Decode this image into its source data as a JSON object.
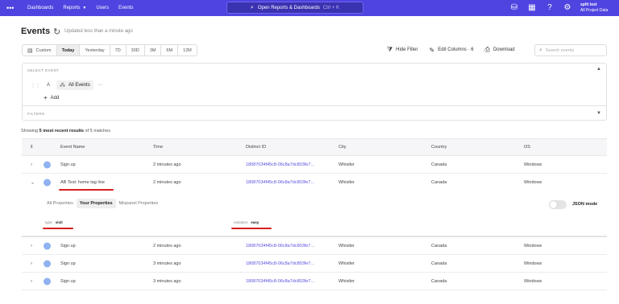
{
  "topnav": {
    "items": [
      {
        "label": "Dashboards"
      },
      {
        "label": "Reports"
      },
      {
        "label": "Users"
      },
      {
        "label": "Events"
      }
    ],
    "search_label": "Open Reports & Dashboards",
    "search_shortcut": "Ctrl + K",
    "user_name": "split test",
    "user_scope": "All Project Data"
  },
  "page": {
    "title": "Events",
    "updated": "Updated less than a minute ago"
  },
  "date_range": {
    "options": [
      "Custom",
      "Today",
      "Yesterday",
      "7D",
      "30D",
      "3M",
      "6M",
      "12M"
    ],
    "selected": "Today"
  },
  "toolbar": {
    "hide_filter": "Hide Filter",
    "edit_columns": "Edit Columns · 6",
    "download": "Download",
    "search_placeholder": "Search events"
  },
  "select_event": {
    "section_label": "SELECT EVENT",
    "letter": "A",
    "event_chip": "All Events",
    "more": "···",
    "add_label": "Add",
    "filters_label": "FILTERS"
  },
  "results": {
    "prefix": "Showing",
    "bold": "5 most recent results",
    "suffix": "of 5 matches"
  },
  "table": {
    "columns": [
      "Event Name",
      "Time",
      "Distinct ID",
      "City",
      "Country",
      "OS"
    ],
    "rows": [
      {
        "event": "Sign up",
        "time": "2 minutes ago",
        "distinct_id": "18087034f45c8-06c8a7dc803fe7...",
        "city": "Whistler",
        "country": "Canada",
        "os": "Windows"
      },
      {
        "event": "AB Test: home tag line",
        "time": "2 minutes ago",
        "distinct_id": "18087034f45c8-06c8a7dc803fe7...",
        "city": "Whistler",
        "country": "Canada",
        "os": "Windows"
      },
      {
        "event": "Sign up",
        "time": "2 minutes ago",
        "distinct_id": "18087034f45c8-06c8a7dc803fe7...",
        "city": "Whistler",
        "country": "Canada",
        "os": "Windows"
      },
      {
        "event": "Sign up",
        "time": "3 minutes ago",
        "distinct_id": "18087034f45c8-06c8a7dc803fe7...",
        "city": "Whistler",
        "country": "Canada",
        "os": "Windows"
      },
      {
        "event": "Sign up",
        "time": "3 minutes ago",
        "distinct_id": "18087034f45c8-06c8a7dc803fe7...",
        "city": "Whistler",
        "country": "Canada",
        "os": "Windows"
      }
    ]
  },
  "expanded": {
    "tabs": [
      "All Properties",
      "Your Properties",
      "Mixpanel Properties"
    ],
    "active_tab": "Your Properties",
    "json_mode": "JSON mode",
    "properties": [
      {
        "key": "type",
        "value": "visit"
      },
      {
        "key": "variation",
        "value": "easy"
      }
    ]
  },
  "colors": {
    "nav": "#4f44e0",
    "link": "#5a4fe0",
    "annotation": "#d81e1e"
  }
}
